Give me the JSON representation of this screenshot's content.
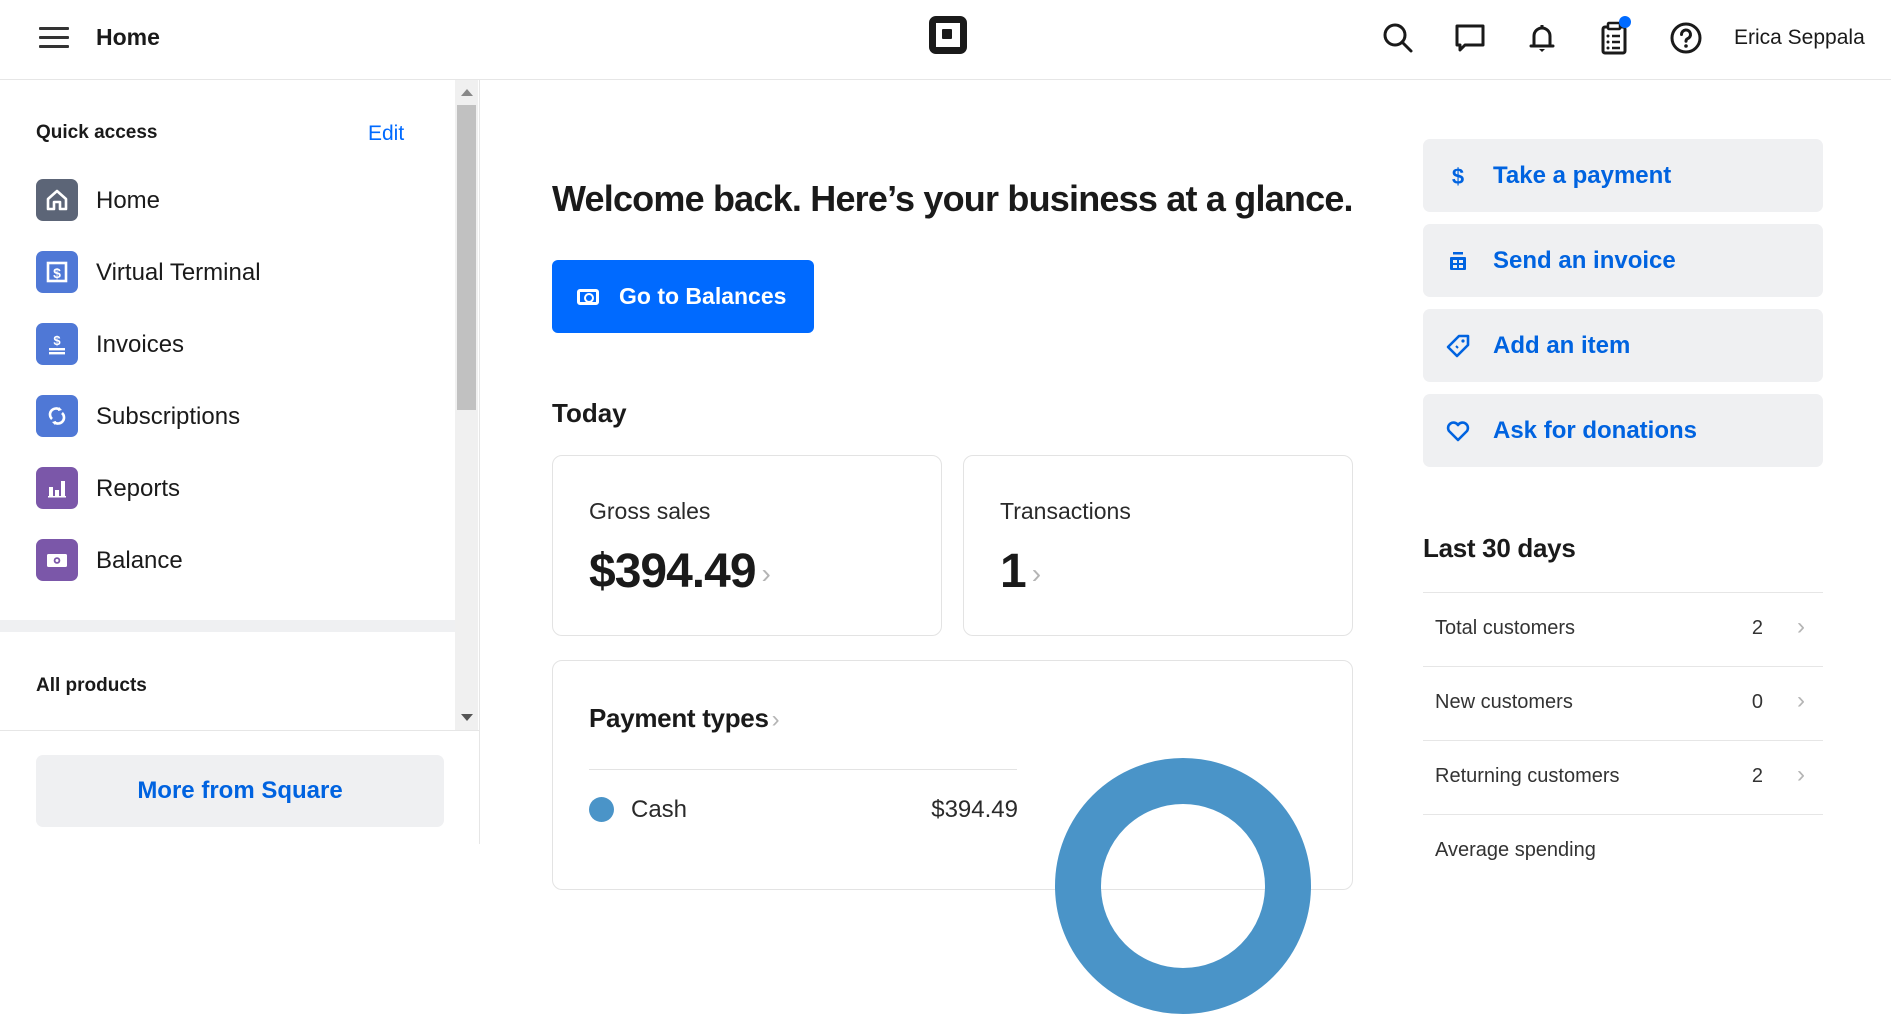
{
  "header": {
    "title": "Home",
    "user_name": "Erica Seppala",
    "icons": [
      "menu-icon",
      "square-logo",
      "search-icon",
      "messages-icon",
      "notifications-icon",
      "clipboard-icon",
      "help-icon"
    ],
    "notification_dot_color": "#006aff"
  },
  "sidebar": {
    "quick_access_title": "Quick access",
    "edit_label": "Edit",
    "items": [
      {
        "label": "Home",
        "icon": "home-icon",
        "color": "#5c6577"
      },
      {
        "label": "Virtual Terminal",
        "icon": "virtual-terminal-icon",
        "color": "#4f78d6"
      },
      {
        "label": "Invoices",
        "icon": "invoices-icon",
        "color": "#4f78d6"
      },
      {
        "label": "Subscriptions",
        "icon": "subscriptions-icon",
        "color": "#4f78d6"
      },
      {
        "label": "Reports",
        "icon": "reports-icon",
        "color": "#7b57a9"
      },
      {
        "label": "Balance",
        "icon": "balance-icon",
        "color": "#7b57a9"
      }
    ],
    "all_products_title": "All products",
    "more_button": "More from Square"
  },
  "main": {
    "welcome": "Welcome back. Here’s your business at a glance.",
    "go_balances": "Go to Balances",
    "today_title": "Today",
    "gross_sales": {
      "label": "Gross sales",
      "value": "$394.49"
    },
    "transactions": {
      "label": "Transactions",
      "value": "1"
    },
    "payment_types": {
      "title": "Payment types",
      "items": [
        {
          "label": "Cash",
          "value": "$394.49",
          "color": "#4a94c8"
        }
      ]
    }
  },
  "actions": [
    {
      "label": "Take a payment",
      "icon": "dollar-icon"
    },
    {
      "label": "Send an invoice",
      "icon": "invoice-icon"
    },
    {
      "label": "Add an item",
      "icon": "tag-icon"
    },
    {
      "label": "Ask for donations",
      "icon": "heart-icon"
    }
  ],
  "last30": {
    "title": "Last 30 days",
    "rows": [
      {
        "label": "Total customers",
        "value": "2"
      },
      {
        "label": "New customers",
        "value": "0"
      },
      {
        "label": "Returning customers",
        "value": "2"
      },
      {
        "label": "Average spending",
        "value": ""
      }
    ]
  },
  "colors": {
    "accent": "#006aff",
    "link": "#0063e0",
    "panel_bg": "#eff0f2"
  }
}
